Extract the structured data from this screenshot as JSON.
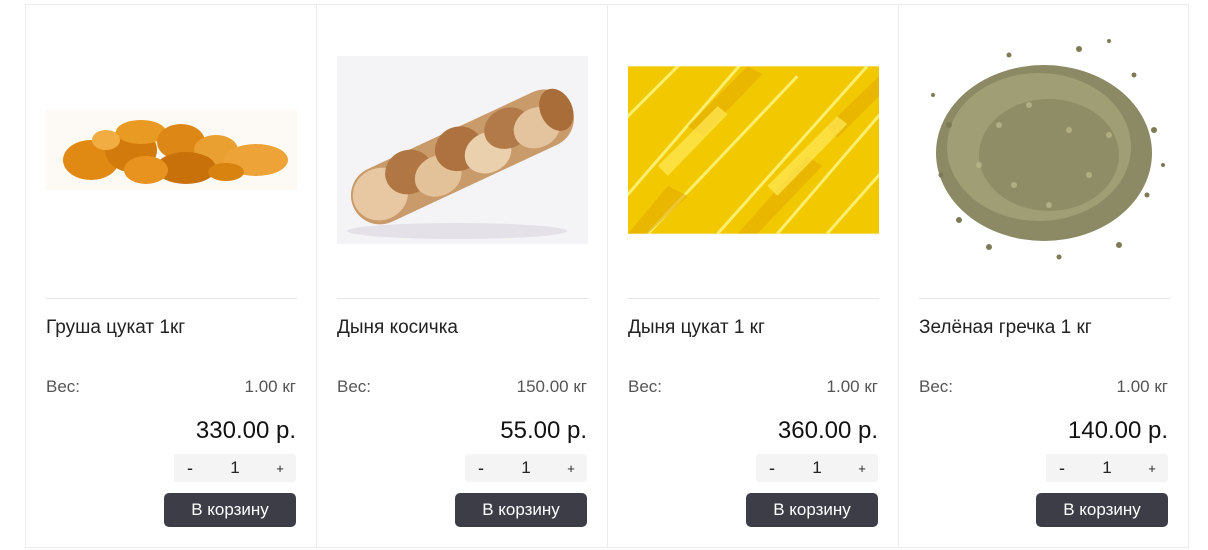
{
  "products": [
    {
      "title": "Груша цукат 1кг",
      "weight_label": "Вес:",
      "weight_value": "1.00 кг",
      "price": "330.00 р.",
      "qty_minus": "-",
      "qty_value": "1",
      "qty_plus": "+",
      "button_label": "В корзину",
      "image": "dried-pear-image"
    },
    {
      "title": "Дыня косичка",
      "weight_label": "Вес:",
      "weight_value": "150.00 кг",
      "price": "55.00 р.",
      "qty_minus": "-",
      "qty_value": "1",
      "qty_plus": "+",
      "button_label": "В корзину",
      "image": "braided-melon-image"
    },
    {
      "title": "Дыня цукат 1 кг",
      "weight_label": "Вес:",
      "weight_value": "1.00 кг",
      "price": "360.00 р.",
      "qty_minus": "-",
      "qty_value": "1",
      "qty_plus": "+",
      "button_label": "В корзину",
      "image": "candied-melon-image"
    },
    {
      "title": "Зелёная гречка 1 кг",
      "weight_label": "Вес:",
      "weight_value": "1.00 кг",
      "price": "140.00 р.",
      "qty_minus": "-",
      "qty_value": "1",
      "qty_plus": "+",
      "button_label": "В корзину",
      "image": "green-buckwheat-image"
    }
  ],
  "colors": {
    "button_bg": "#3d3d48",
    "button_text": "#ffffff",
    "qty_bg": "#f4f4f5",
    "border": "#ececec"
  }
}
